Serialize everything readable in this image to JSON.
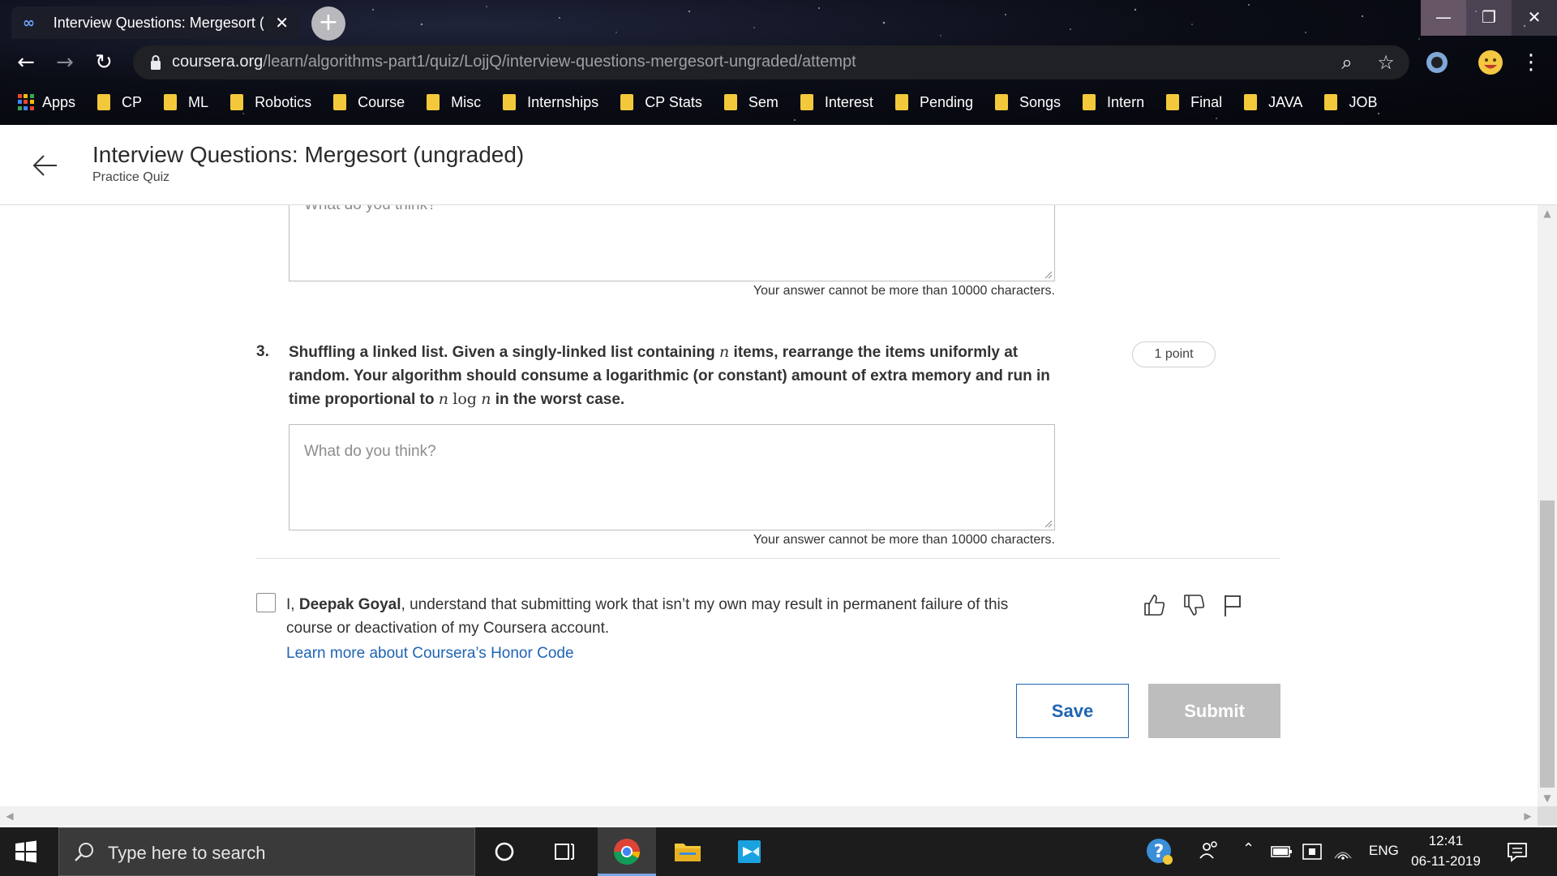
{
  "browser": {
    "tab_title": "Interview Questions: Mergesort (ungraded) | Coursera",
    "tab_close": "✕",
    "new_tab": "+",
    "window_buttons": {
      "minimize": "—",
      "maximize": "❐",
      "close": "✕"
    },
    "url_host": "coursera.org",
    "url_path": "/learn/algorithms-part1/quiz/LojjQ/interview-questions-mergesort-ungraded/attempt",
    "bookmarks": [
      {
        "label": "Apps",
        "icon": "apps-grid-icon"
      },
      {
        "label": "CP",
        "icon": "folder-icon"
      },
      {
        "label": "ML",
        "icon": "folder-icon"
      },
      {
        "label": "Robotics",
        "icon": "folder-icon"
      },
      {
        "label": "Course",
        "icon": "folder-icon"
      },
      {
        "label": "Misc",
        "icon": "folder-icon"
      },
      {
        "label": "Internships",
        "icon": "folder-icon"
      },
      {
        "label": "CP Stats",
        "icon": "folder-icon"
      },
      {
        "label": "Sem",
        "icon": "folder-icon"
      },
      {
        "label": "Interest",
        "icon": "folder-icon"
      },
      {
        "label": "Pending",
        "icon": "folder-icon"
      },
      {
        "label": "Songs",
        "icon": "folder-icon"
      },
      {
        "label": "Intern",
        "icon": "folder-icon"
      },
      {
        "label": "Final",
        "icon": "folder-icon"
      },
      {
        "label": "JAVA",
        "icon": "folder-icon"
      },
      {
        "label": "JOB",
        "icon": "folder-icon"
      }
    ]
  },
  "header": {
    "title": "Interview Questions: Mergesort (ungraded)",
    "subtitle": "Practice Quiz"
  },
  "quiz": {
    "prev_answer_placeholder": "What do you think?",
    "char_limit_note": "Your answer cannot be more than 10000 characters.",
    "question": {
      "number": "3.",
      "text_part1": "Shuffling a linked list. Given a singly-linked list containing ",
      "var_n": "n",
      "text_part2": " items, rearrange the items uniformly at random. Your algorithm should consume a logarithmic (or constant) amount of extra memory and run in time proportional to ",
      "log": "log",
      "text_part3": " in the worst case.",
      "points": "1 point",
      "answer_placeholder": "What do you think?",
      "char_limit_note": "Your answer cannot be more than 10000 characters."
    },
    "honor": {
      "prefix": "I, ",
      "name": "Deepak Goyal",
      "suffix": ", understand that submitting work that isn’t my own may result in permanent failure of this course or deactivation of my Coursera account.",
      "link": "Learn more about Coursera’s Honor Code"
    },
    "save_label": "Save",
    "submit_label": "Submit"
  },
  "taskbar": {
    "search_placeholder": "Type here to search",
    "language": "ENG",
    "time": "12:41",
    "date": "06-11-2019"
  },
  "colors": {
    "accent_blue": "#1f64b4",
    "submit_disabled": "#bdbdbd",
    "bookmark_folder": "#f3c93b",
    "taskbar": "#1c1c1c"
  }
}
